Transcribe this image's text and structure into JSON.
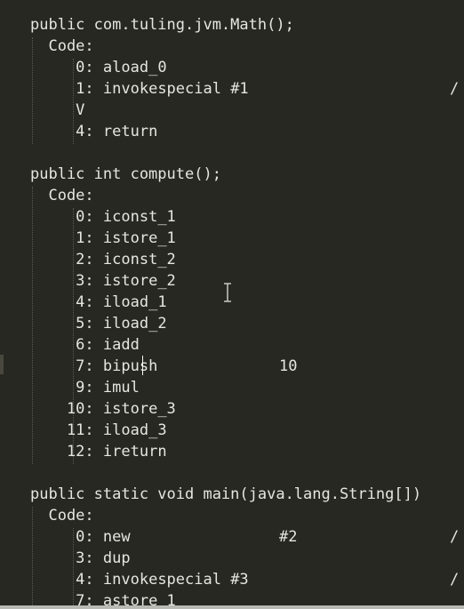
{
  "colors": {
    "background": "#272822",
    "text": "#e6e6e0"
  },
  "lines": [
    {
      "type": "method",
      "text": "public com.tuling.jvm.Math();"
    },
    {
      "type": "label",
      "text": "  Code:"
    },
    {
      "type": "instr",
      "offset": "     0:",
      "op": "aload_0",
      "arg": "",
      "comment": ""
    },
    {
      "type": "instr",
      "offset": "     1:",
      "op": "invokespecial #1",
      "arg": "",
      "comment": "/"
    },
    {
      "type": "raw",
      "text": "     V"
    },
    {
      "type": "instr",
      "offset": "     4:",
      "op": "return",
      "arg": "",
      "comment": ""
    },
    {
      "type": "blank",
      "text": ""
    },
    {
      "type": "method",
      "text": "public int compute();"
    },
    {
      "type": "label",
      "text": "  Code:"
    },
    {
      "type": "instr",
      "offset": "     0:",
      "op": "iconst_1",
      "arg": "",
      "comment": ""
    },
    {
      "type": "instr",
      "offset": "     1:",
      "op": "istore_1",
      "arg": "",
      "comment": ""
    },
    {
      "type": "instr",
      "offset": "     2:",
      "op": "iconst_2",
      "arg": "",
      "comment": ""
    },
    {
      "type": "instr",
      "offset": "     3:",
      "op": "istore_2",
      "arg": "",
      "comment": ""
    },
    {
      "type": "instr",
      "offset": "     4:",
      "op": "iload_1",
      "arg": "",
      "comment": ""
    },
    {
      "type": "instr",
      "offset": "     5:",
      "op": "iload_2",
      "arg": "",
      "comment": ""
    },
    {
      "type": "instr",
      "offset": "     6:",
      "op": "iadd",
      "arg": "",
      "comment": ""
    },
    {
      "type": "instr",
      "offset": "     7:",
      "op": "bipush",
      "arg": "10",
      "comment": ""
    },
    {
      "type": "instr",
      "offset": "     9:",
      "op": "imul",
      "arg": "",
      "comment": ""
    },
    {
      "type": "instr",
      "offset": "    10:",
      "op": "istore_3",
      "arg": "",
      "comment": ""
    },
    {
      "type": "instr",
      "offset": "    11:",
      "op": "iload_3",
      "arg": "",
      "comment": ""
    },
    {
      "type": "instr",
      "offset": "    12:",
      "op": "ireturn",
      "arg": "",
      "comment": ""
    },
    {
      "type": "blank",
      "text": ""
    },
    {
      "type": "method",
      "text": "public static void main(java.lang.String[])"
    },
    {
      "type": "label",
      "text": "  Code:"
    },
    {
      "type": "instr",
      "offset": "     0:",
      "op": "new",
      "arg": "#2",
      "comment": "/"
    },
    {
      "type": "instr",
      "offset": "     3:",
      "op": "dup",
      "arg": "",
      "comment": ""
    },
    {
      "type": "instr",
      "offset": "     4:",
      "op": "invokespecial #3",
      "arg": "",
      "comment": "/"
    },
    {
      "type": "instr",
      "offset": "     7:",
      "op": "astore_1",
      "arg": "",
      "comment": ""
    }
  ]
}
